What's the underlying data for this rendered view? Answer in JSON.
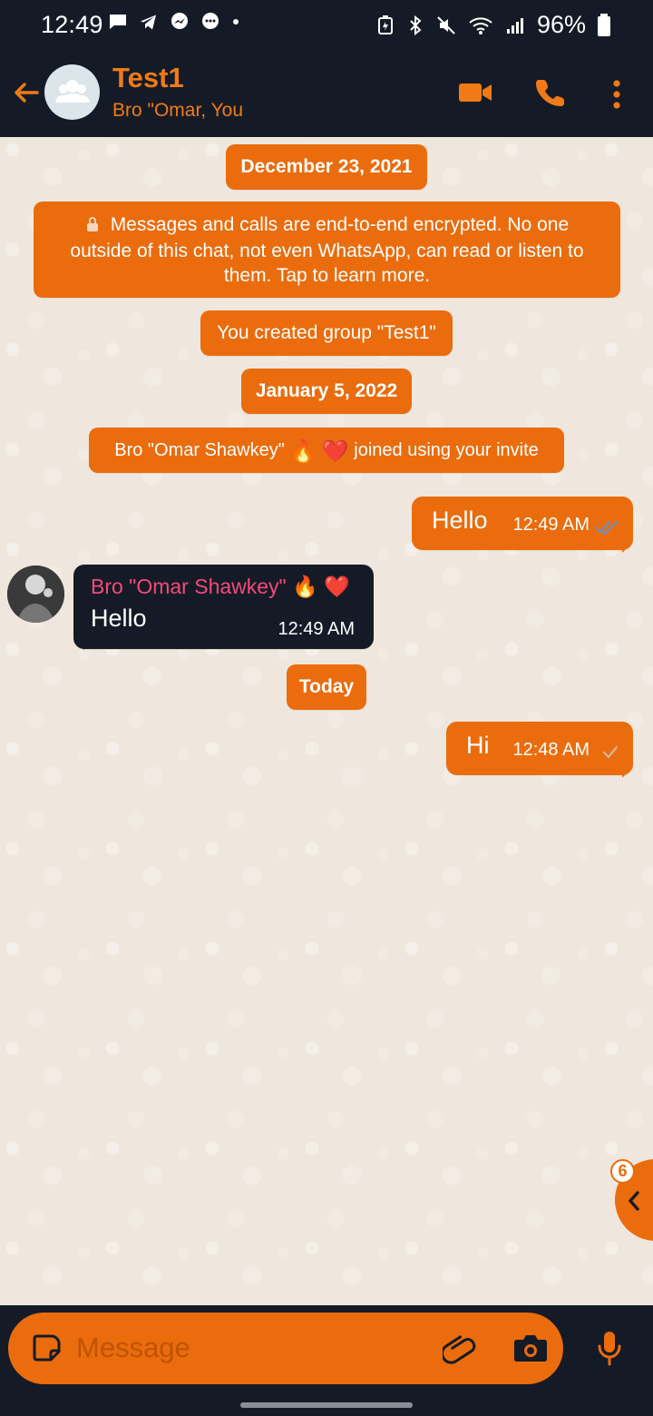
{
  "status_bar": {
    "time": "12:49",
    "battery_percent": "96%"
  },
  "header": {
    "title": "Test1",
    "subtitle": "Bro \"Omar, You"
  },
  "messages": {
    "date_1": "December 23, 2021",
    "encrypted_notice": "Messages and calls are end-to-end encrypted. No one outside of this chat, not even WhatsApp, can read or listen to them. Tap to learn more.",
    "group_created": "You created group \"Test1\"",
    "date_2": "January 5, 2022",
    "joined_prefix": "Bro \"Omar Shawkey\"",
    "joined_fire": "🔥",
    "joined_heart": "❤️",
    "joined_suffix": "joined using your invite",
    "outgoing_1": {
      "text": "Hello",
      "time": "12:49 AM"
    },
    "incoming_1": {
      "sender": "Bro \"Omar Shawkey\"",
      "sender_fire": "🔥",
      "sender_heart": "❤️",
      "text": "Hello",
      "time": "12:49 AM"
    },
    "today": "Today",
    "outgoing_2": {
      "text": "Hi",
      "time": "12:48 AM"
    }
  },
  "unread": {
    "count": "6"
  },
  "composer": {
    "placeholder": "Message"
  },
  "colors": {
    "accent": "#ea6c0d",
    "header_bg": "#151b26",
    "incoming_bubble": "#151b26",
    "sender_name": "#f24a7b",
    "chat_bg": "#efe7dd"
  },
  "icons": {
    "back": "back-arrow-icon",
    "group_avatar": "group-icon",
    "video": "video-call-icon",
    "phone": "phone-icon",
    "menu": "more-vertical-icon",
    "sticker": "sticker-icon",
    "attach": "paperclip-icon",
    "camera": "camera-icon",
    "mic": "microphone-icon",
    "unread_chevron": "chevron-left-icon"
  }
}
